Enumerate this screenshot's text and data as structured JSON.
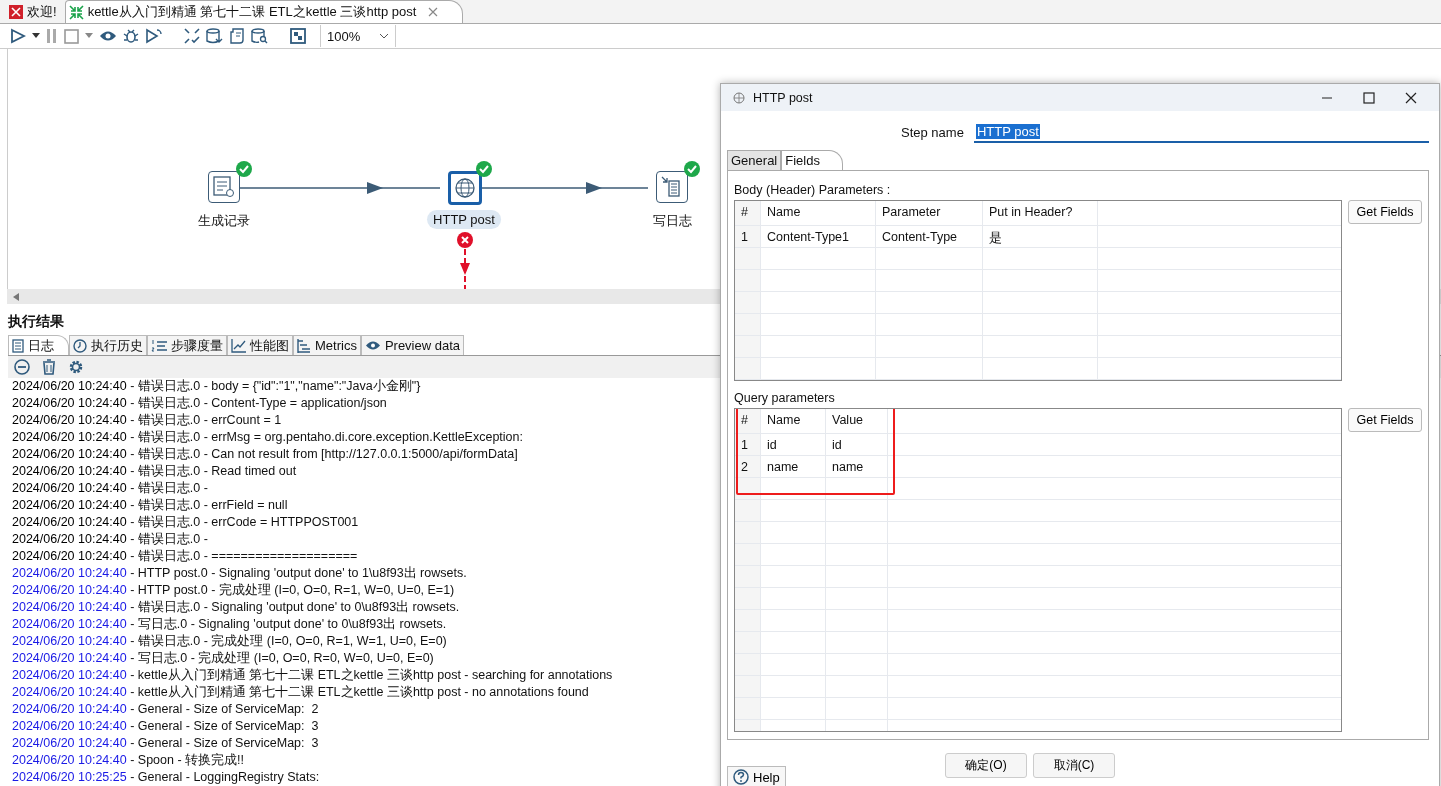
{
  "editor_tabs": [
    {
      "label": "欢迎!",
      "selected": false,
      "kind": "welcome"
    },
    {
      "label": "kettle从入门到精通 第七十二课 ETL之kettle 三谈http post",
      "selected": true,
      "kind": "transformation"
    }
  ],
  "toolbar": {
    "zoom": "100%"
  },
  "canvas": {
    "steps": [
      {
        "label": "生成记录",
        "kind": "generator",
        "ok": true,
        "selected": false,
        "error": false
      },
      {
        "label": "HTTP post",
        "kind": "http",
        "ok": true,
        "selected": true,
        "error": true
      },
      {
        "label": "写日志",
        "kind": "writelog",
        "ok": true,
        "selected": false,
        "error": false
      }
    ]
  },
  "results": {
    "title": "执行结果",
    "tabs": [
      {
        "label": "日志",
        "kind": "log",
        "selected": true
      },
      {
        "label": "执行历史",
        "kind": "history",
        "selected": false
      },
      {
        "label": "步骤度量",
        "kind": "steps",
        "selected": false
      },
      {
        "label": "性能图",
        "kind": "chart",
        "selected": false
      },
      {
        "label": "Metrics",
        "kind": "metrics",
        "selected": false
      },
      {
        "label": "Preview data",
        "kind": "preview",
        "selected": false
      }
    ],
    "log": [
      {
        "time": "2024/06/20 10:24:40",
        "message": " - 错误日志.0 - body = {\"id\":\"1\",\"name\":\"Java小金刚\"}",
        "color": "#000000"
      },
      {
        "time": "2024/06/20 10:24:40",
        "message": " - 错误日志.0 - Content-Type = application/json",
        "color": "#000000"
      },
      {
        "time": "2024/06/20 10:24:40",
        "message": " - 错误日志.0 - errCount = 1",
        "color": "#000000"
      },
      {
        "time": "2024/06/20 10:24:40",
        "message": " - 错误日志.0 - errMsg = org.pentaho.di.core.exception.KettleException:",
        "color": "#000000"
      },
      {
        "time": "2024/06/20 10:24:40",
        "message": " - 错误日志.0 - Can not result from [http://127.0.0.1:5000/api/formData]",
        "color": "#000000"
      },
      {
        "time": "2024/06/20 10:24:40",
        "message": " - 错误日志.0 - Read timed out",
        "color": "#000000"
      },
      {
        "time": "2024/06/20 10:24:40",
        "message": " - 错误日志.0 -",
        "color": "#000000"
      },
      {
        "time": "2024/06/20 10:24:40",
        "message": " - 错误日志.0 - errField = null",
        "color": "#000000"
      },
      {
        "time": "2024/06/20 10:24:40",
        "message": " - 错误日志.0 - errCode = HTTPPOST001",
        "color": "#000000"
      },
      {
        "time": "2024/06/20 10:24:40",
        "message": " - 错误日志.0 -",
        "color": "#000000"
      },
      {
        "time": "2024/06/20 10:24:40",
        "message": " - 错误日志.0 - ====================",
        "color": "#000000"
      },
      {
        "time": "2024/06/20 10:24:40",
        "message": " - HTTP post.0 - Signaling 'output done' to 1\\u8f93出 rowsets.",
        "color": "#1a1ae6"
      },
      {
        "time": "2024/06/20 10:24:40",
        "message": " - HTTP post.0 - 完成处理 (I=0, O=0, R=1, W=0, U=0, E=1)",
        "color": "#1a1ae6"
      },
      {
        "time": "2024/06/20 10:24:40",
        "message": " - 错误日志.0 - Signaling 'output done' to 0\\u8f93出 rowsets.",
        "color": "#1a1ae6"
      },
      {
        "time": "2024/06/20 10:24:40",
        "message": " - 写日志.0 - Signaling 'output done' to 0\\u8f93出 rowsets.",
        "color": "#1a1ae6"
      },
      {
        "time": "2024/06/20 10:24:40",
        "message": " - 错误日志.0 - 完成处理 (I=0, O=0, R=1, W=1, U=0, E=0)",
        "color": "#1a1ae6"
      },
      {
        "time": "2024/06/20 10:24:40",
        "message": " - 写日志.0 - 完成处理 (I=0, O=0, R=0, W=0, U=0, E=0)",
        "color": "#1a1ae6"
      },
      {
        "time": "2024/06/20 10:24:40",
        "message": " - kettle从入门到精通 第七十二课 ETL之kettle 三谈http post - searching for annotations",
        "color": "#1a1ae6"
      },
      {
        "time": "2024/06/20 10:24:40",
        "message": " - kettle从入门到精通 第七十二课 ETL之kettle 三谈http post - no annotations found",
        "color": "#1a1ae6"
      },
      {
        "time": "2024/06/20 10:24:40",
        "message": " - General - Size of ServiceMap:  2",
        "color": "#1a1ae6"
      },
      {
        "time": "2024/06/20 10:24:40",
        "message": " - General - Size of ServiceMap:  3",
        "color": "#1a1ae6"
      },
      {
        "time": "2024/06/20 10:24:40",
        "message": " - General - Size of ServiceMap:  3",
        "color": "#1a1ae6"
      },
      {
        "time": "2024/06/20 10:24:40",
        "message": " - Spoon - 转换完成!!",
        "color": "#1a1ae6"
      },
      {
        "time": "2024/06/20 10:25:25",
        "message": " - General - LoggingRegistry Stats:",
        "color": "#1a1ae6"
      }
    ]
  },
  "dialog": {
    "title": "HTTP post",
    "step_name_label": "Step name",
    "step_name": "HTTP post",
    "tabs": [
      {
        "label": "General",
        "selected": false
      },
      {
        "label": "Fields",
        "selected": true
      }
    ],
    "body_params": {
      "title": "Body (Header) Parameters :",
      "columns": [
        "#",
        "Name",
        "Parameter",
        "Put in Header?"
      ],
      "rows": [
        [
          "1",
          "Content-Type1",
          "Content-Type",
          "是"
        ]
      ],
      "button": "Get Fields"
    },
    "query_params": {
      "title": "Query parameters",
      "highlighted": true,
      "columns": [
        "#",
        "Name",
        "Value"
      ],
      "rows": [
        [
          "1",
          "id",
          "id"
        ],
        [
          "2",
          "name",
          "name"
        ]
      ],
      "button": "Get Fields"
    },
    "buttons": [
      "确定(O)",
      "取消(C)"
    ],
    "help": "Help"
  }
}
